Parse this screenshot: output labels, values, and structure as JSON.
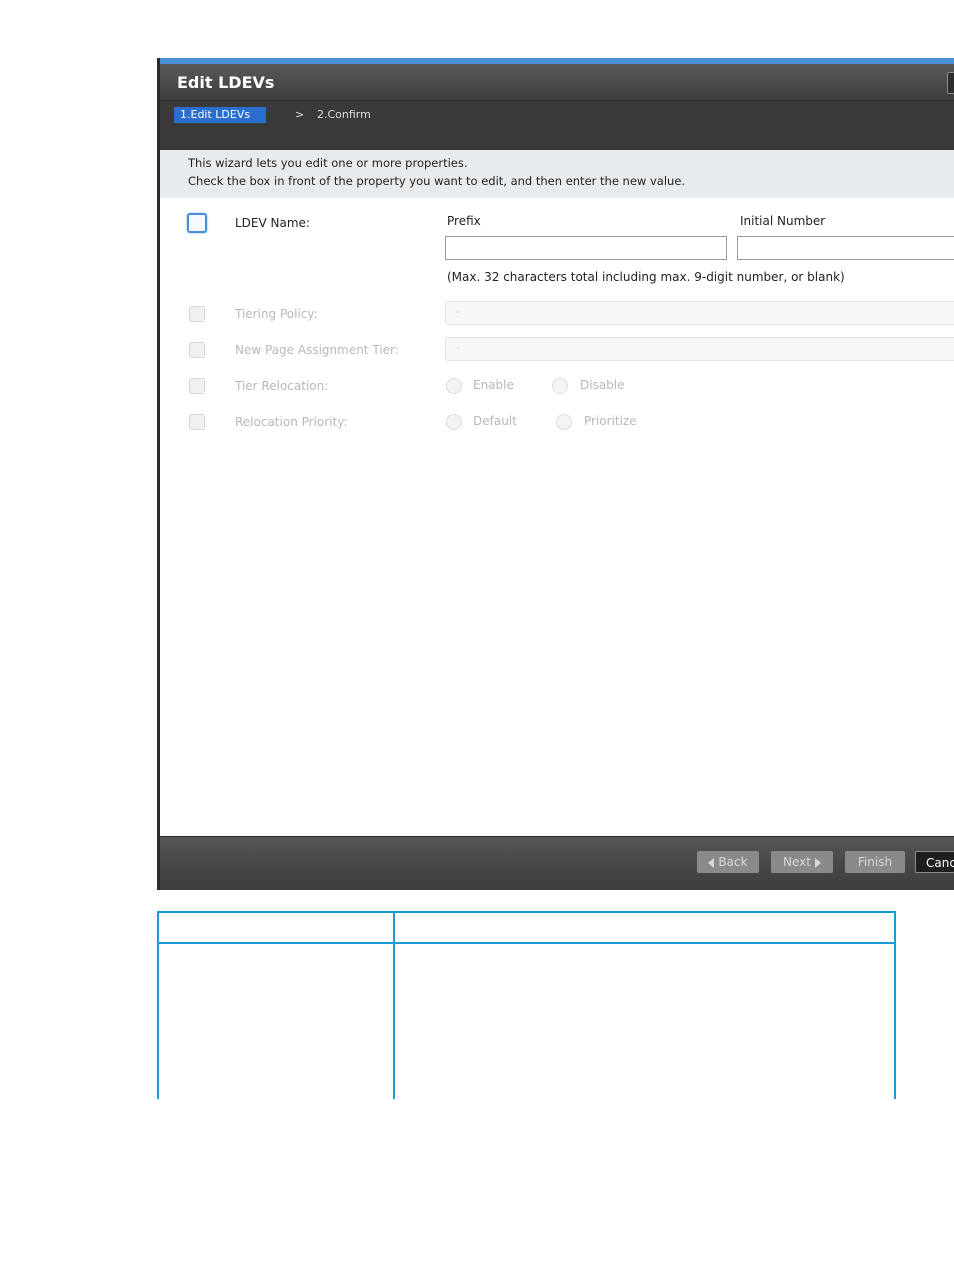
{
  "dialog": {
    "title": "Edit LDEVs",
    "steps": {
      "active": "1.Edit LDEVs",
      "separator": ">",
      "next": "2.Confirm"
    },
    "info": {
      "line1": "This wizard lets you edit one or more properties.",
      "line2": "Check the  box in front of the property you want to edit, and then enter the new value."
    },
    "ldev_name": {
      "label": "LDEV Name:",
      "prefix_header": "Prefix",
      "initial_number_header": "Initial Number",
      "prefix_value": "",
      "initial_number_value": "",
      "hint": "(Max. 32 characters total including max. 9-digit number, or blank)"
    },
    "tiering_policy": {
      "label": "Tiering Policy:",
      "value": "-"
    },
    "new_page_assignment_tier": {
      "label": "New Page Assignment Tier:",
      "value": "-"
    },
    "tier_relocation": {
      "label": "Tier Relocation:",
      "option1": "Enable",
      "option2": "Disable"
    },
    "relocation_priority": {
      "label": "Relocation Priority:",
      "option1": "Default",
      "option2": "Prioritize"
    },
    "footer": {
      "back": "Back",
      "next": "Next",
      "finish": "Finish",
      "cancel": "Cancel"
    }
  }
}
